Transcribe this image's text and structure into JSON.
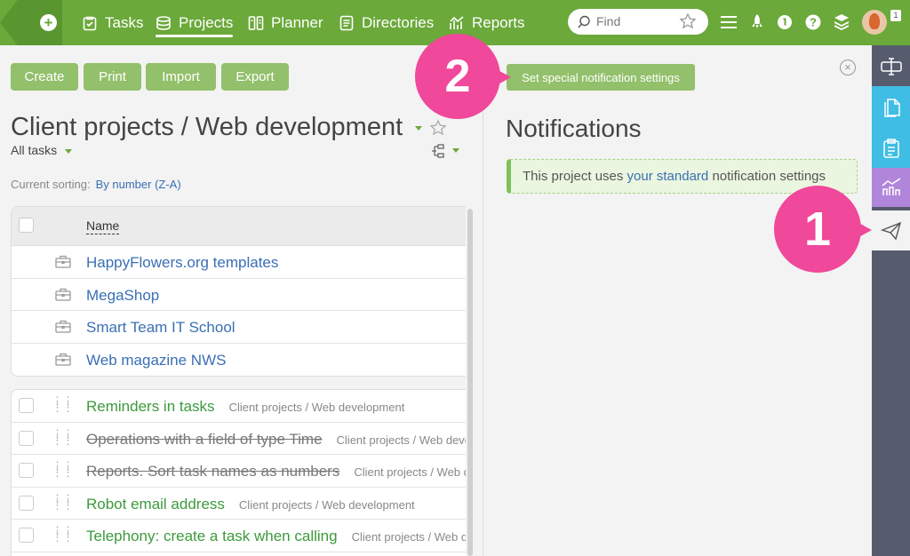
{
  "nav": {
    "items": [
      {
        "label": "Tasks"
      },
      {
        "label": "Projects"
      },
      {
        "label": "Planner"
      },
      {
        "label": "Directories"
      },
      {
        "label": "Reports"
      }
    ]
  },
  "search": {
    "placeholder": "Find"
  },
  "user": {
    "badge": "1"
  },
  "toolbar": {
    "create": "Create",
    "print": "Print",
    "import": "Import",
    "export": "Export"
  },
  "project": {
    "title": "Client projects / Web development",
    "filter": "All tasks",
    "sorting_label": "Current sorting:",
    "sorting_value": "By number (Z-A)"
  },
  "projects_table": {
    "column_name": "Name",
    "rows": [
      {
        "name": "HappyFlowers.org templates"
      },
      {
        "name": "MegaShop"
      },
      {
        "name": "Smart Team IT School"
      },
      {
        "name": "Web magazine NWS"
      }
    ]
  },
  "tasks": [
    {
      "name": "Reminders in tasks",
      "path": "Client projects / Web development",
      "done": false
    },
    {
      "name": "Operations with a field of type Time",
      "path": "Client projects / Web development",
      "done": true
    },
    {
      "name": "Reports. Sort task names as numbers",
      "path": "Client projects / Web development",
      "done": true
    },
    {
      "name": "Robot email address",
      "path": "Client projects / Web development",
      "done": false
    },
    {
      "name": "Telephony: create a task when calling",
      "path": "Client projects / Web development",
      "done": false
    }
  ],
  "notifications": {
    "title": "Notifications",
    "special_button": "Set special notification settings",
    "info_prefix": "This project uses ",
    "info_link": "your standard",
    "info_suffix": " notification settings"
  },
  "callouts": {
    "one": "1",
    "two": "2"
  },
  "colors": {
    "brand": "#6ba93a",
    "button": "#93c06b",
    "link": "#3a6fb5",
    "task_green": "#3c9a3c",
    "callout": "#f0489a",
    "sidebar": "#565c6e"
  }
}
